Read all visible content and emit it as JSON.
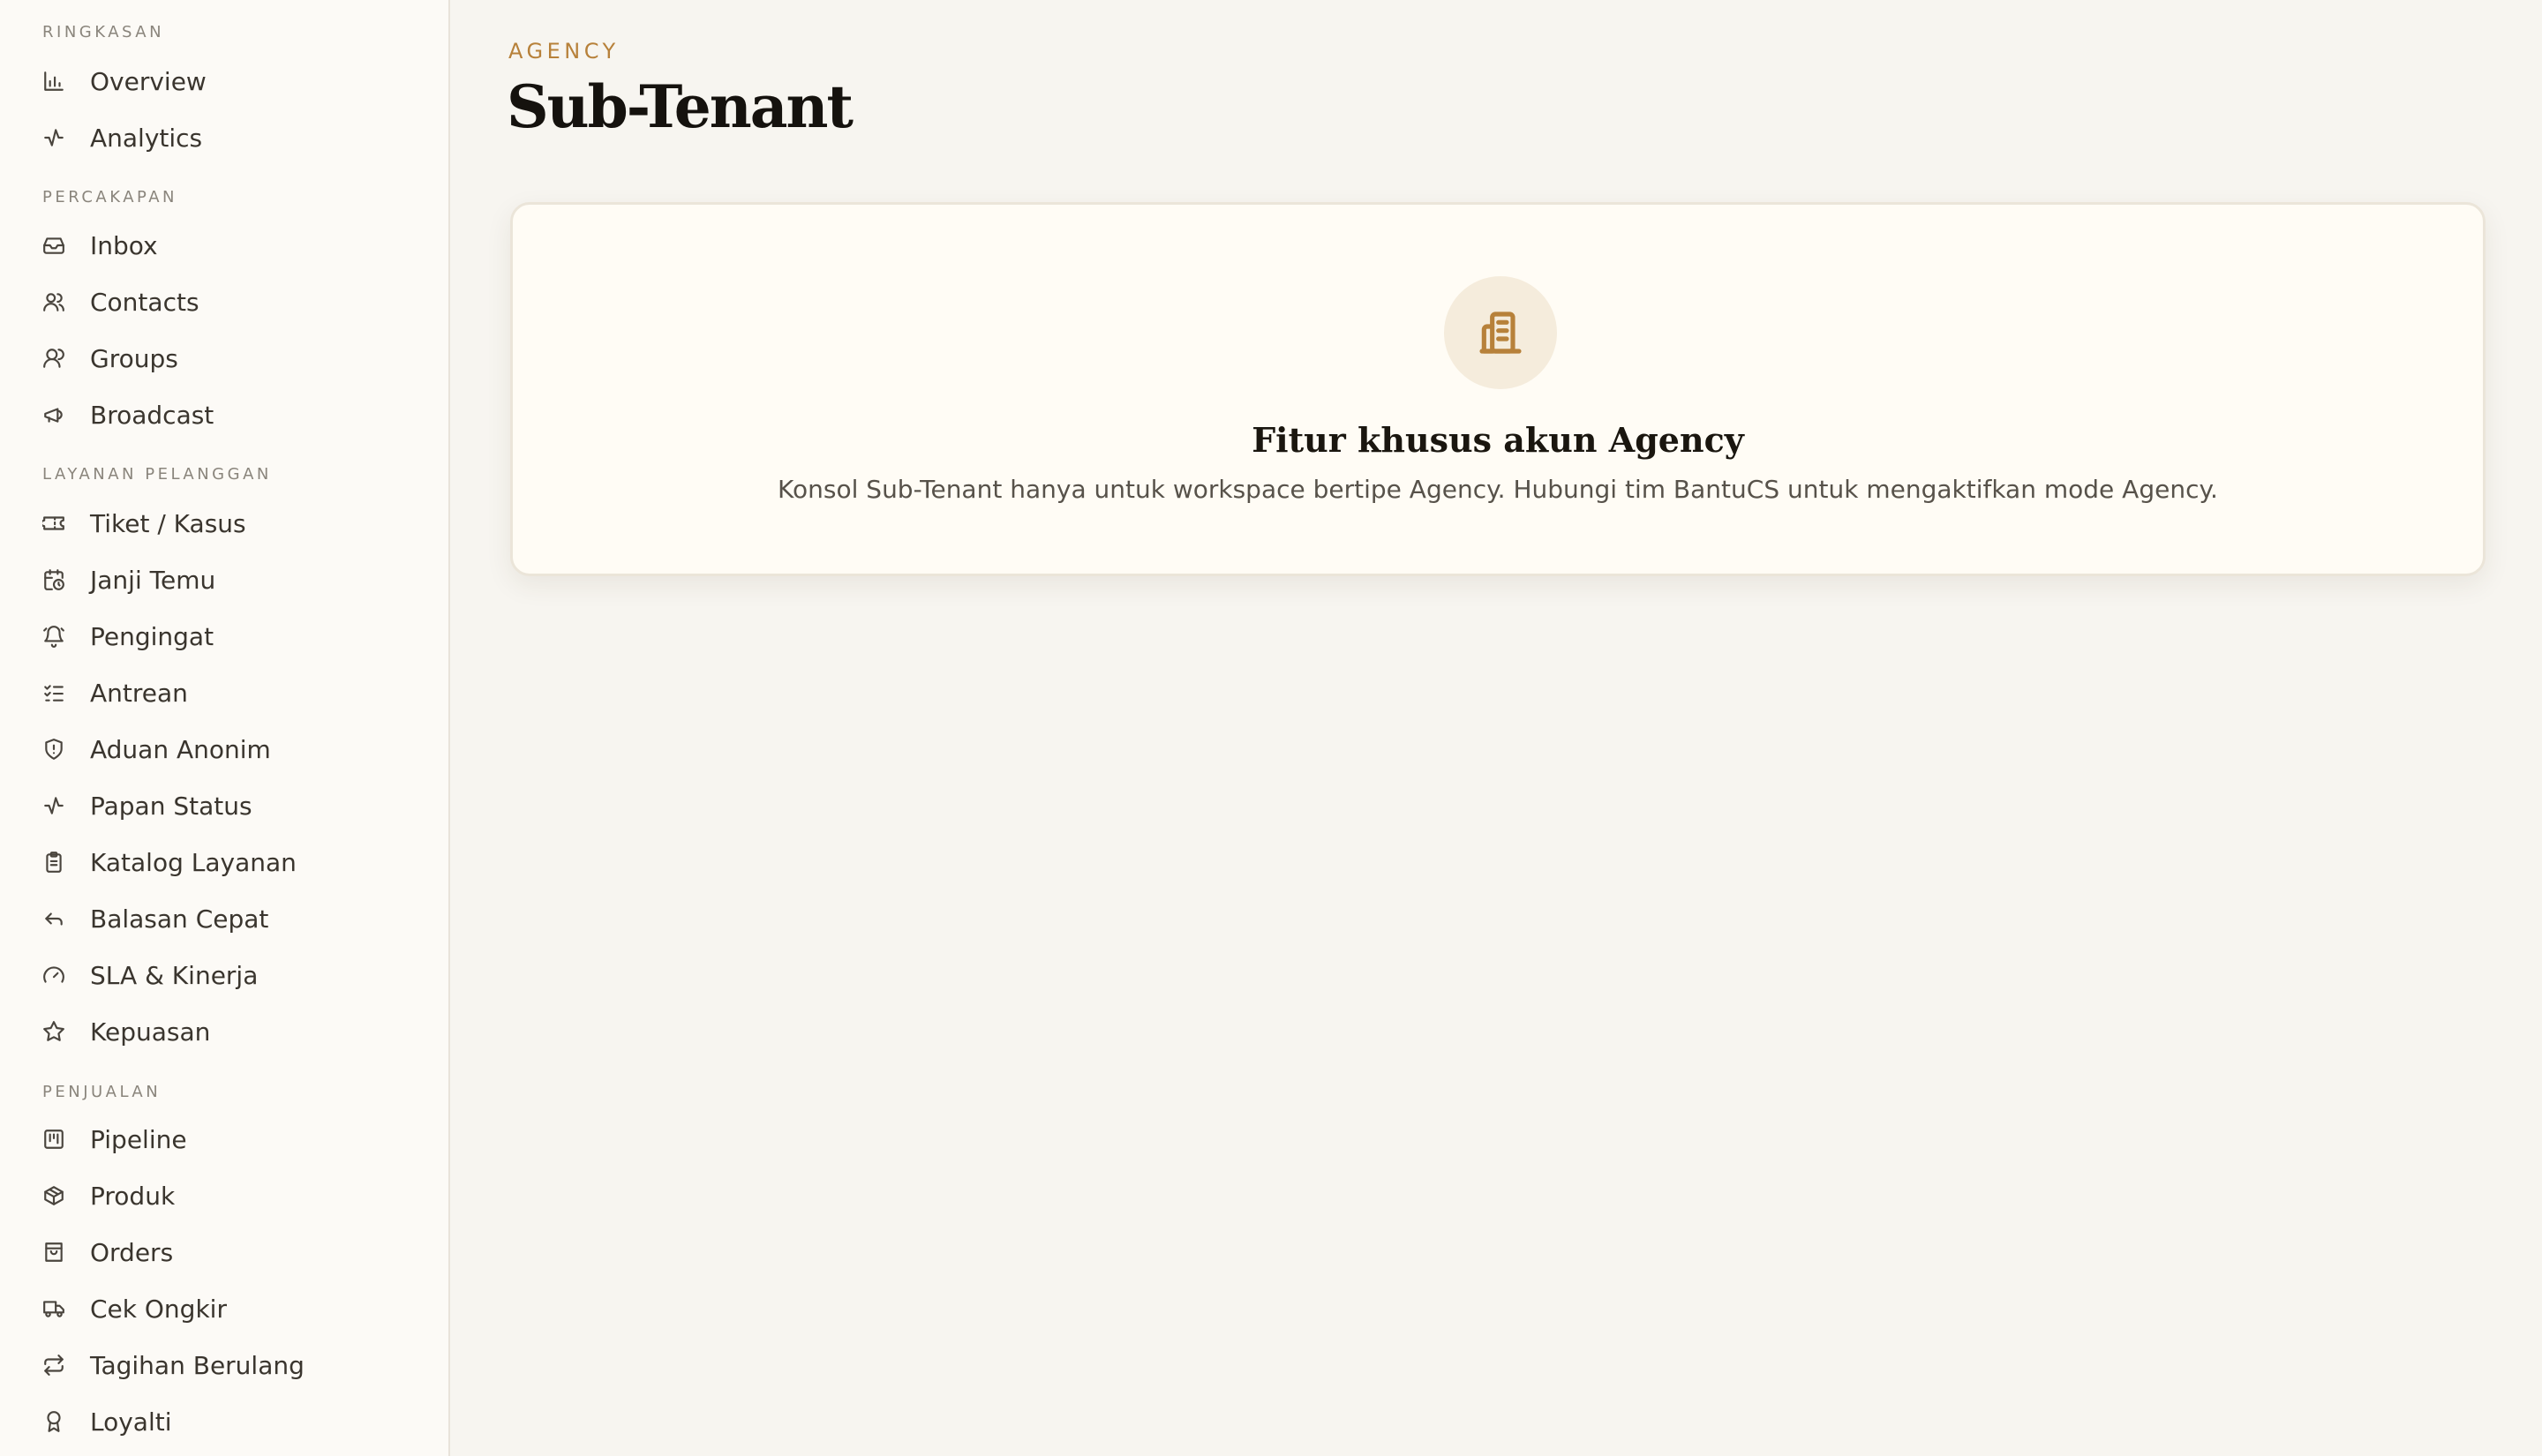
{
  "sidebar": {
    "sections": [
      {
        "label": "RINGKASAN",
        "items": [
          {
            "label": "Overview",
            "icon": "bar-chart-icon"
          },
          {
            "label": "Analytics",
            "icon": "activity-icon"
          }
        ]
      },
      {
        "label": "PERCAKAPAN",
        "items": [
          {
            "label": "Inbox",
            "icon": "inbox-icon"
          },
          {
            "label": "Contacts",
            "icon": "users-icon"
          },
          {
            "label": "Groups",
            "icon": "user-group-icon"
          },
          {
            "label": "Broadcast",
            "icon": "megaphone-icon"
          }
        ]
      },
      {
        "label": "LAYANAN PELANGGAN",
        "items": [
          {
            "label": "Tiket / Kasus",
            "icon": "ticket-icon"
          },
          {
            "label": "Janji Temu",
            "icon": "calendar-clock-icon"
          },
          {
            "label": "Pengingat",
            "icon": "bell-icon"
          },
          {
            "label": "Antrean",
            "icon": "list-checks-icon"
          },
          {
            "label": "Aduan Anonim",
            "icon": "shield-icon"
          },
          {
            "label": "Papan Status",
            "icon": "pulse-icon"
          },
          {
            "label": "Katalog Layanan",
            "icon": "clipboard-icon"
          },
          {
            "label": "Balasan Cepat",
            "icon": "reply-icon"
          },
          {
            "label": "SLA & Kinerja",
            "icon": "gauge-icon"
          },
          {
            "label": "Kepuasan",
            "icon": "star-icon"
          }
        ]
      },
      {
        "label": "PENJUALAN",
        "items": [
          {
            "label": "Pipeline",
            "icon": "kanban-icon"
          },
          {
            "label": "Produk",
            "icon": "package-icon"
          },
          {
            "label": "Orders",
            "icon": "shopping-bag-icon"
          },
          {
            "label": "Cek Ongkir",
            "icon": "truck-icon"
          },
          {
            "label": "Tagihan Berulang",
            "icon": "repeat-icon"
          },
          {
            "label": "Loyalti",
            "icon": "award-icon"
          }
        ]
      }
    ]
  },
  "header": {
    "eyebrow": "AGENCY",
    "title": "Sub-Tenant"
  },
  "card": {
    "icon": "building-icon",
    "title": "Fitur khusus akun Agency",
    "description": "Konsol Sub-Tenant hanya untuk workspace bertipe Agency. Hubungi tim BantuCS untuk mengaktifkan mode Agency."
  },
  "colors": {
    "accent": "#b7813a",
    "background": "#f7f5f0",
    "sidebar": "#fcfaf6",
    "card": "#fffcf5"
  }
}
